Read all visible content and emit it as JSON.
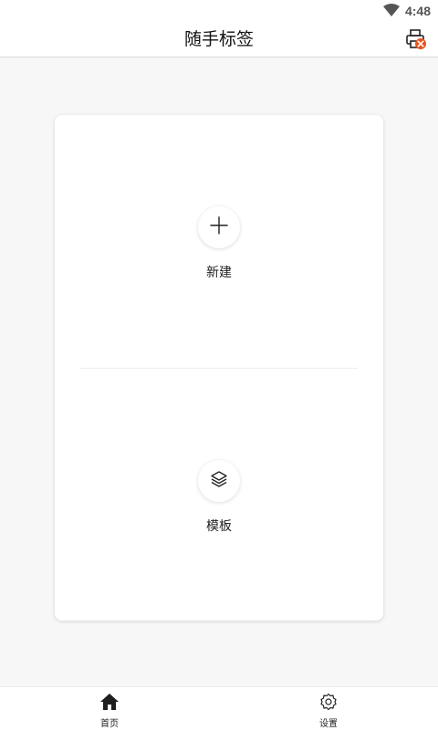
{
  "status_bar": {
    "time": "4:48",
    "wifi_icon": "wifi-icon"
  },
  "app_bar": {
    "title": "随手标签",
    "printer_icon": "printer-disconnected-icon",
    "accent": "#e8541e"
  },
  "card": {
    "new_label": "新建",
    "new_icon": "plus-icon",
    "template_label": "模板",
    "template_icon": "layers-icon"
  },
  "bottom_nav": {
    "items": [
      {
        "label": "首页",
        "icon": "home-icon",
        "active": true
      },
      {
        "label": "设置",
        "icon": "gear-icon",
        "active": false
      }
    ]
  }
}
